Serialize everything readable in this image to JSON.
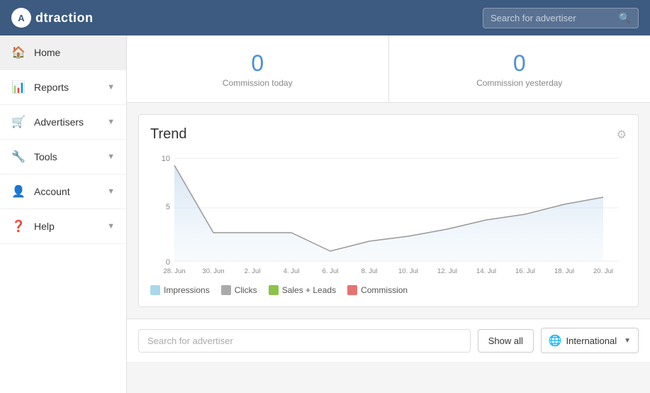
{
  "header": {
    "logo_text": "dtraction",
    "logo_letter": "A",
    "search_placeholder": "Search for advertiser"
  },
  "sidebar": {
    "items": [
      {
        "id": "home",
        "label": "Home",
        "icon": "⌂",
        "active": true,
        "has_chevron": false
      },
      {
        "id": "reports",
        "label": "Reports",
        "icon": "📊",
        "active": false,
        "has_chevron": true
      },
      {
        "id": "advertisers",
        "label": "Advertisers",
        "icon": "🛒",
        "active": false,
        "has_chevron": true
      },
      {
        "id": "tools",
        "label": "Tools",
        "icon": "🔧",
        "active": false,
        "has_chevron": true
      },
      {
        "id": "account",
        "label": "Account",
        "icon": "👤",
        "active": false,
        "has_chevron": true
      },
      {
        "id": "help",
        "label": "Help",
        "icon": "❓",
        "active": false,
        "has_chevron": true
      }
    ]
  },
  "commission": {
    "today_value": "0",
    "today_label": "Commission today",
    "yesterday_value": "0",
    "yesterday_label": "Commission yesterday"
  },
  "chart": {
    "title": "Trend",
    "y_labels": [
      "10",
      "5",
      "0"
    ],
    "x_labels": [
      "28. Jun",
      "30. Jun",
      "2. Jul",
      "4. Jul",
      "6. Jul",
      "8. Jul",
      "10. Jul",
      "12. Jul",
      "14. Jul",
      "16. Jul",
      "18. Jul",
      "20. Jul"
    ],
    "legend": [
      {
        "label": "Impressions",
        "color": "#a8d8ea"
      },
      {
        "label": "Clicks",
        "color": "#aaa"
      },
      {
        "label": "Sales + Leads",
        "color": "#8bc34a"
      },
      {
        "label": "Commission",
        "color": "#e57373"
      }
    ]
  },
  "bottom_bar": {
    "search_placeholder": "Search for advertiser",
    "show_all_label": "Show all",
    "international_label": "International"
  }
}
